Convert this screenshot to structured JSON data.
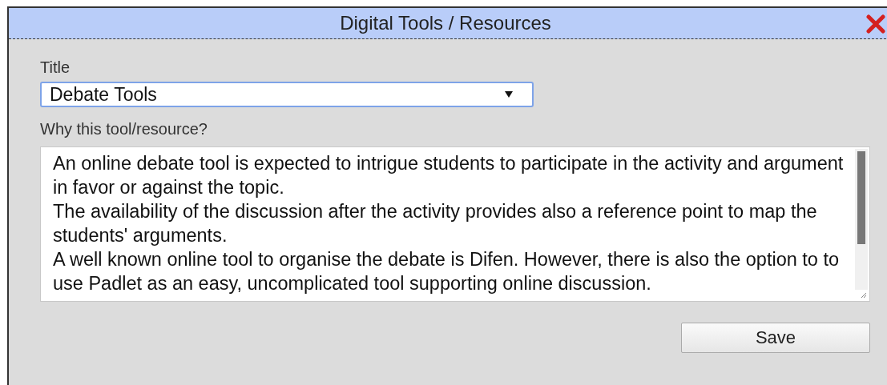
{
  "dialog": {
    "title": "Digital Tools / Resources"
  },
  "title_field": {
    "label": "Title",
    "value": "Debate Tools"
  },
  "reason_field": {
    "label": "Why this tool/resource?",
    "paragraphs": [
      "An online debate tool is expected to intrigue students to participate in the activity and argument in favor or against the topic.",
      "The availability of the discussion after the activity provides also a reference point to map the students' arguments.",
      "A well known online tool to organise the debate is Difen. However, there is also the option to to use Padlet as an easy, uncomplicated tool supporting online discussion."
    ]
  },
  "buttons": [
    {
      "label": "Save"
    }
  ]
}
